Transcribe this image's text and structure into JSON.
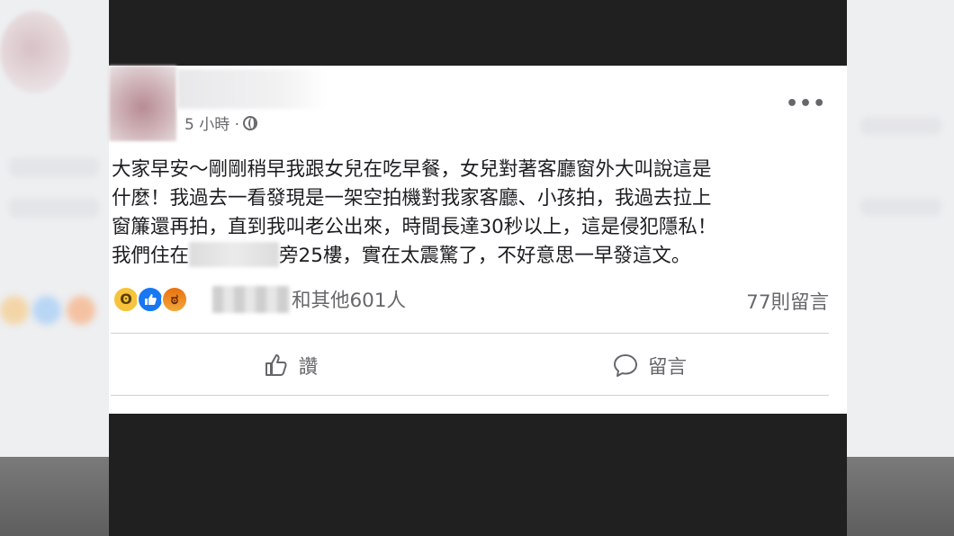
{
  "post": {
    "timestamp": "5 小時 ·",
    "body_lines": [
      "大家早安～剛剛稍早我跟女兒在吃早餐，女兒對著客廳窗外大叫說這是",
      "什麼！我過去一看發現是一架空拍機對我家客廳、小孩拍，我過去拉上",
      "窗簾還再拍，直到我叫老公出來，時間長達30秒以上，這是侵犯隱私！"
    ],
    "last_line_prefix": "我們住在",
    "last_line_suffix": "旁25樓，實在太震驚了，不好意思一早發這文。",
    "reaction_icons": [
      "wow-icon",
      "like-icon",
      "angry-icon"
    ],
    "reactors_text": "和其他601人",
    "comment_count": "77則留言",
    "actions": {
      "like_label": "讚",
      "comment_label": "留言"
    },
    "colors": {
      "like_blue": "#1877f2",
      "secondary_text": "#65676b",
      "body_text": "#1c1e21"
    }
  }
}
